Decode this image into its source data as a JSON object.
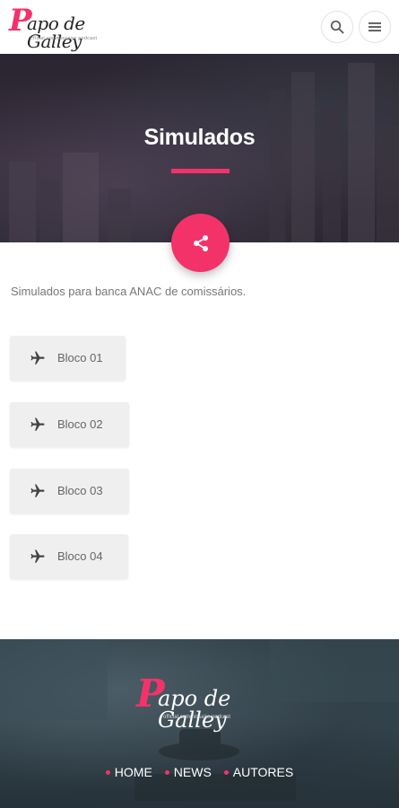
{
  "header": {
    "logo": {
      "initial": "P",
      "text": "apo de Galley",
      "tagline": "official commissaire podcast"
    },
    "search_icon": "search-icon",
    "menu_icon": "hamburger-menu-icon"
  },
  "hero": {
    "title": "Simulados",
    "accent_color": "#f4326a"
  },
  "share_icon": "share-icon",
  "intro": "Simulados para banca ANAC de comissários.",
  "blocos": [
    {
      "label": "Bloco 01",
      "icon": "airplane-icon"
    },
    {
      "label": "Bloco 02",
      "icon": "airplane-icon"
    },
    {
      "label": "Bloco 03",
      "icon": "airplane-icon"
    },
    {
      "label": "Bloco 04",
      "icon": "airplane-icon"
    }
  ],
  "footer": {
    "logo": {
      "initial": "P",
      "text": "apo de Galley",
      "tagline": "official commissaire podcast"
    },
    "nav": [
      "HOME",
      "NEWS",
      "AUTORES"
    ]
  }
}
